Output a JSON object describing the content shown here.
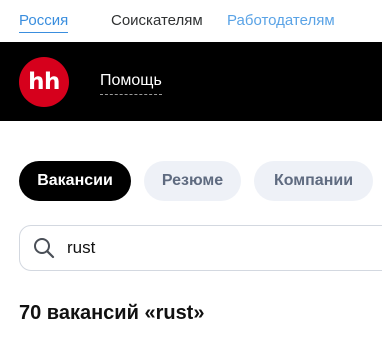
{
  "top_nav": {
    "region_label": "Россия",
    "seekers_label": "Соискателям",
    "employers_label": "Работодателям",
    "colors": {
      "region": "#3a8ede",
      "employers": "#5aa3e6",
      "seekers": "#303233"
    }
  },
  "header": {
    "logo_text": "hh",
    "help_label": "Помощь",
    "colors": {
      "background": "#000000",
      "logo": "#d6001c"
    }
  },
  "tabs": [
    {
      "label": "Вакансии",
      "selected": true
    },
    {
      "label": "Резюме",
      "selected": false
    },
    {
      "label": "Компании",
      "selected": false
    }
  ],
  "search": {
    "icon": "search-icon",
    "value": "rust"
  },
  "results": {
    "title": "70 вакансий «rust»"
  }
}
